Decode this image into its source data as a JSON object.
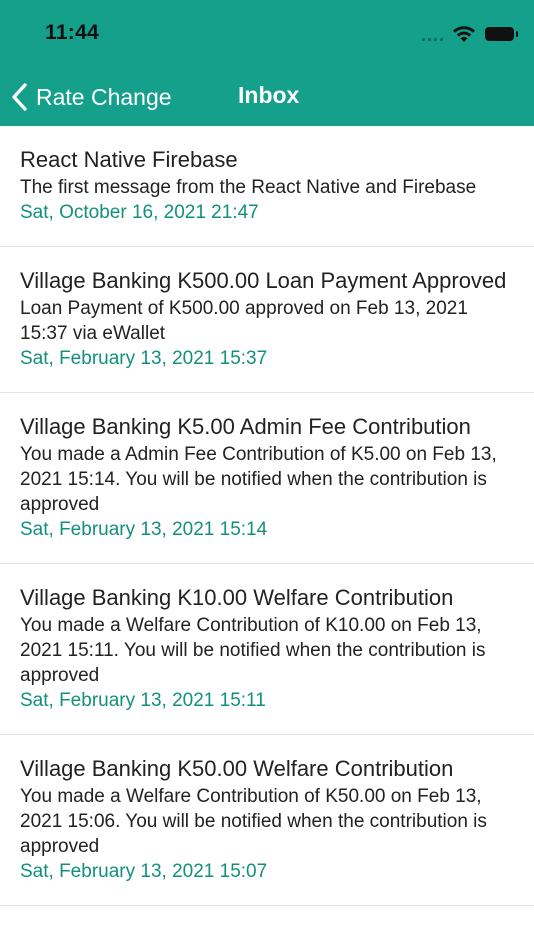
{
  "status_bar": {
    "time": "11:44"
  },
  "header": {
    "back_label": "Rate Change",
    "title": "Inbox",
    "bg_color": "#14a08a"
  },
  "messages": [
    {
      "title": "React Native Firebase",
      "body": "The first message from the React Native and Firebase",
      "date": "Sat, October 16, 2021 21:47"
    },
    {
      "title": "Village Banking K500.00 Loan Payment Approved",
      "body": "Loan Payment of K500.00 approved on Feb 13, 2021 15:37 via eWallet",
      "date": "Sat, February 13, 2021 15:37"
    },
    {
      "title": "Village Banking K5.00 Admin Fee Contribution",
      "body": "You made a Admin Fee Contribution of K5.00 on Feb 13, 2021 15:14. You will be notified when the contribution is approved",
      "date": "Sat, February 13, 2021 15:14"
    },
    {
      "title": "Village Banking K10.00 Welfare Contribution",
      "body": "You made a Welfare Contribution of K10.00 on Feb 13, 2021 15:11. You will be notified when the contribution is approved",
      "date": "Sat, February 13, 2021 15:11"
    },
    {
      "title": "Village Banking K50.00 Welfare Contribution",
      "body": "You made a Welfare Contribution of K50.00 on Feb 13, 2021 15:06. You will be notified when the contribution is approved",
      "date": "Sat, February 13, 2021 15:07"
    }
  ],
  "colors": {
    "accent": "#14a08a",
    "date_text": "#12907c"
  }
}
